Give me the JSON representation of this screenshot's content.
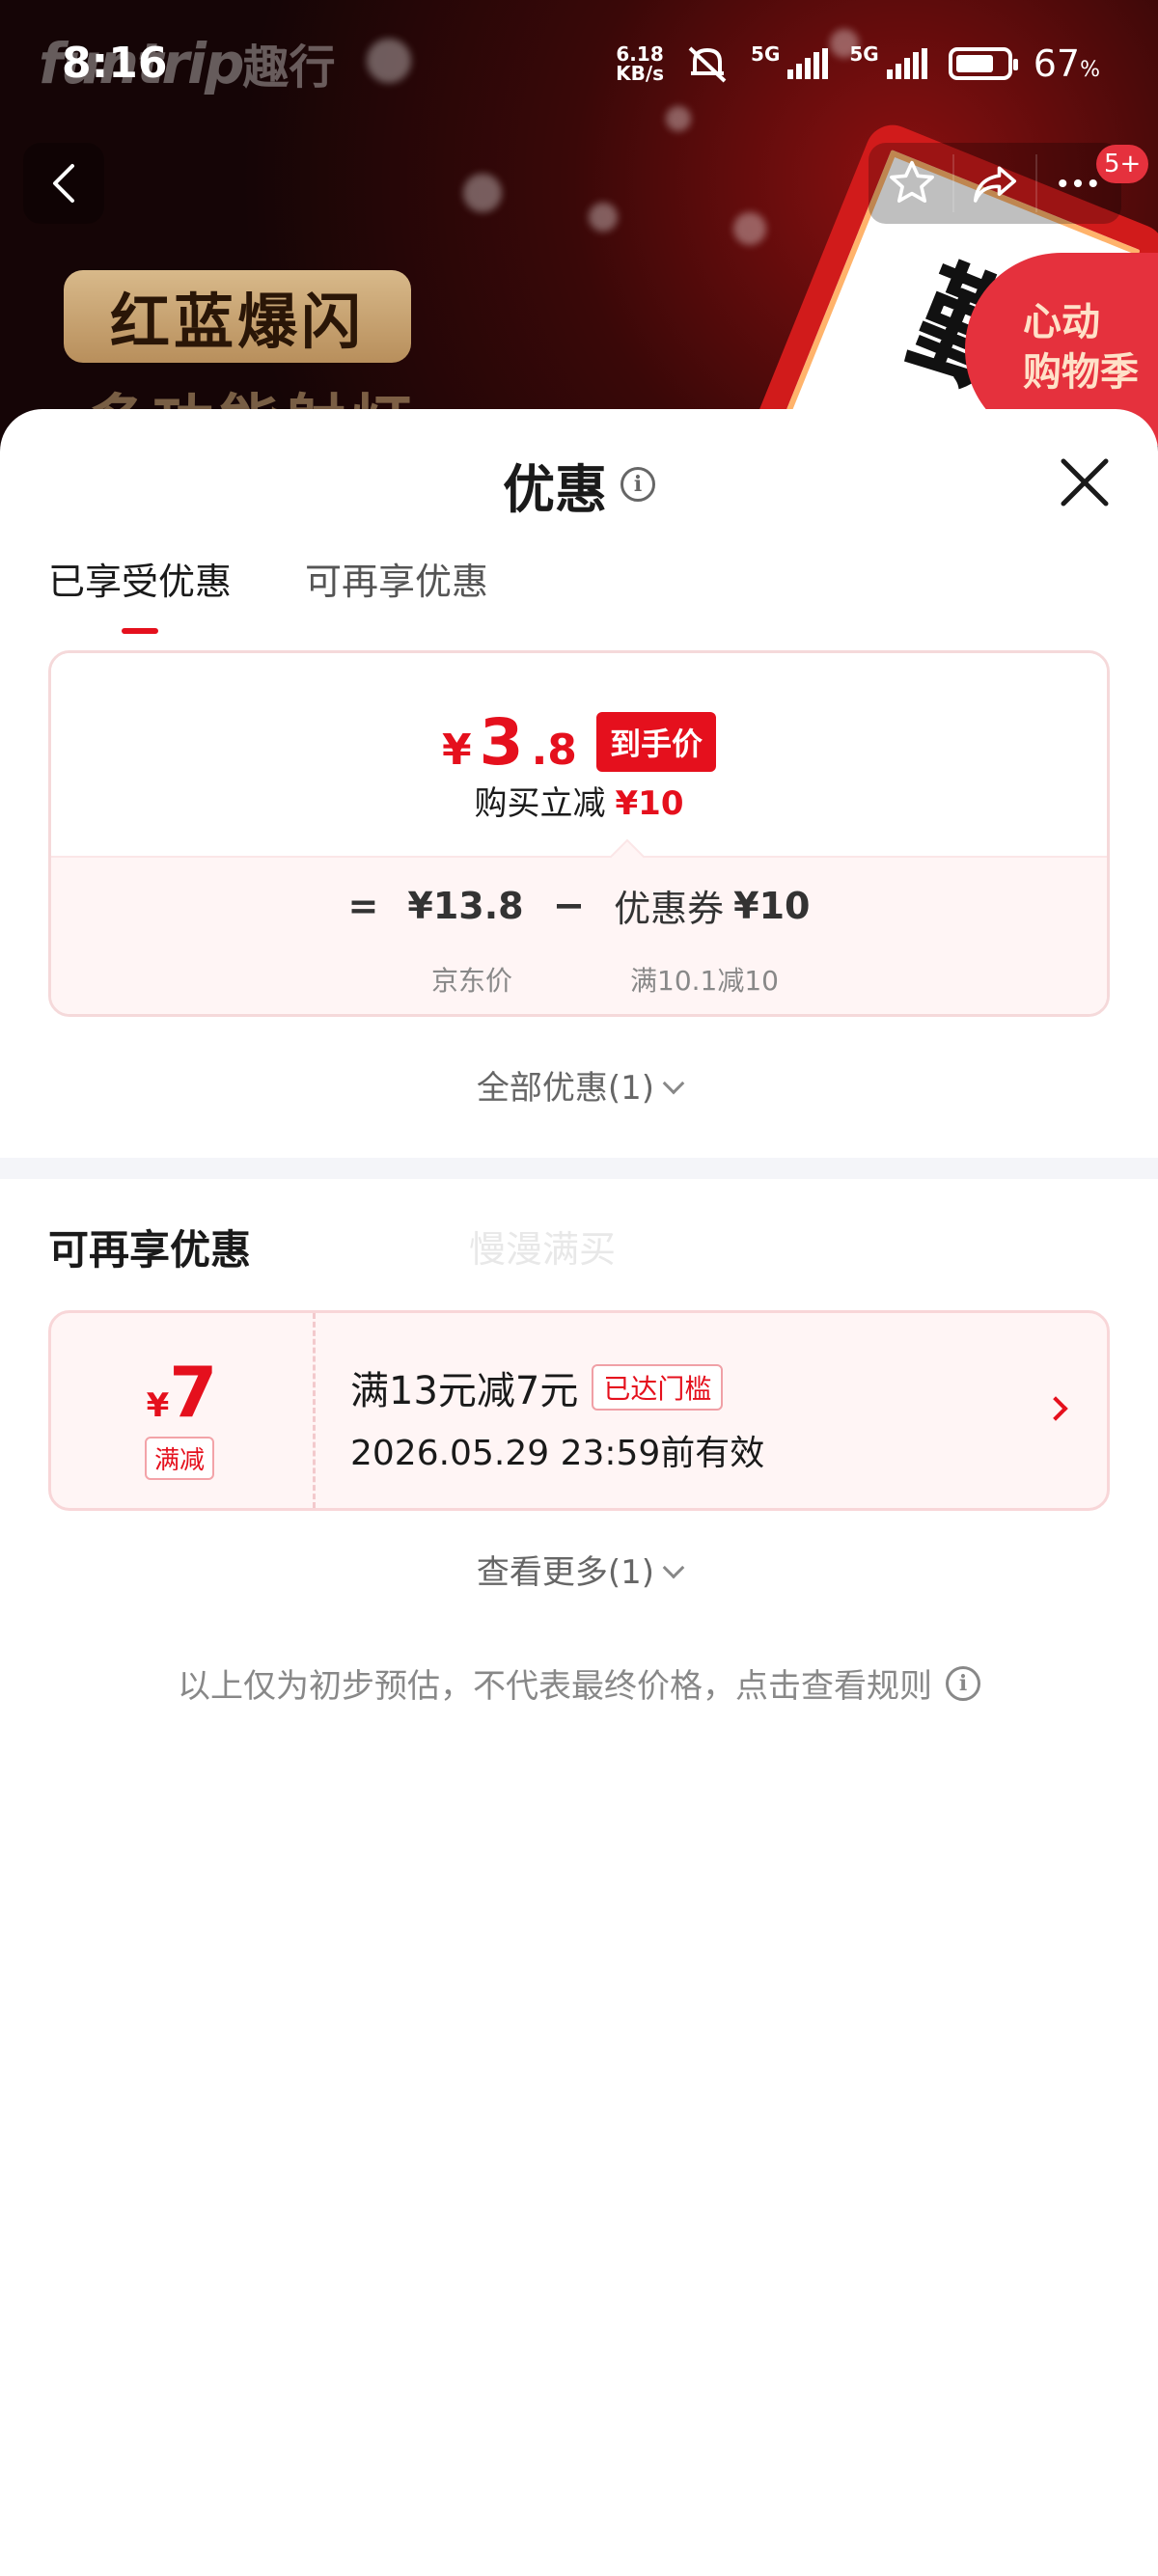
{
  "status_bar": {
    "time": "8:16",
    "net_speed_value": "6.18",
    "net_speed_unit": "KB/s",
    "network_1": "5G",
    "network_2": "5G",
    "battery_value": "67",
    "battery_unit": "%"
  },
  "background": {
    "logo_text": "funtrip",
    "logo_cn": "趣行",
    "promo_tag": "红蓝爆闪",
    "promo_sub": "多功能射灯",
    "product_text": "勤",
    "event_badge_line1": "心动",
    "event_badge_line2": "购物季",
    "message_count": "5+"
  },
  "sheet": {
    "title": "优惠",
    "tabs": [
      {
        "label": "已享受优惠",
        "active": true
      },
      {
        "label": "可再享优惠",
        "active": false
      }
    ],
    "price_card": {
      "currency": "¥",
      "final_price_int": "3",
      "final_price_dec": ".8",
      "final_tag": "到手价",
      "reduce_label": "购买立减",
      "reduce_amount": "¥10",
      "equals": "=",
      "original_price": "¥13.8",
      "original_label": "京东价",
      "minus": "−",
      "coupon_label": "优惠券",
      "coupon_amount": "¥10",
      "coupon_condition": "满10.1减10"
    },
    "all_promos": "全部优惠(1)",
    "section_title": "可再享优惠",
    "watermark": "慢漫满买",
    "coupon": {
      "currency": "¥",
      "amount": "7",
      "type": "满减",
      "title": "满13元减7元",
      "badge": "已达门槛",
      "valid_until": "2026.05.29 23:59前有效"
    },
    "see_more": "查看更多(1)",
    "disclaimer": "以上仅为初步预估，不代表最终价格，点击查看规则"
  },
  "colors": {
    "accent_red": "#e5101d",
    "card_bg": "#fff5f5"
  }
}
